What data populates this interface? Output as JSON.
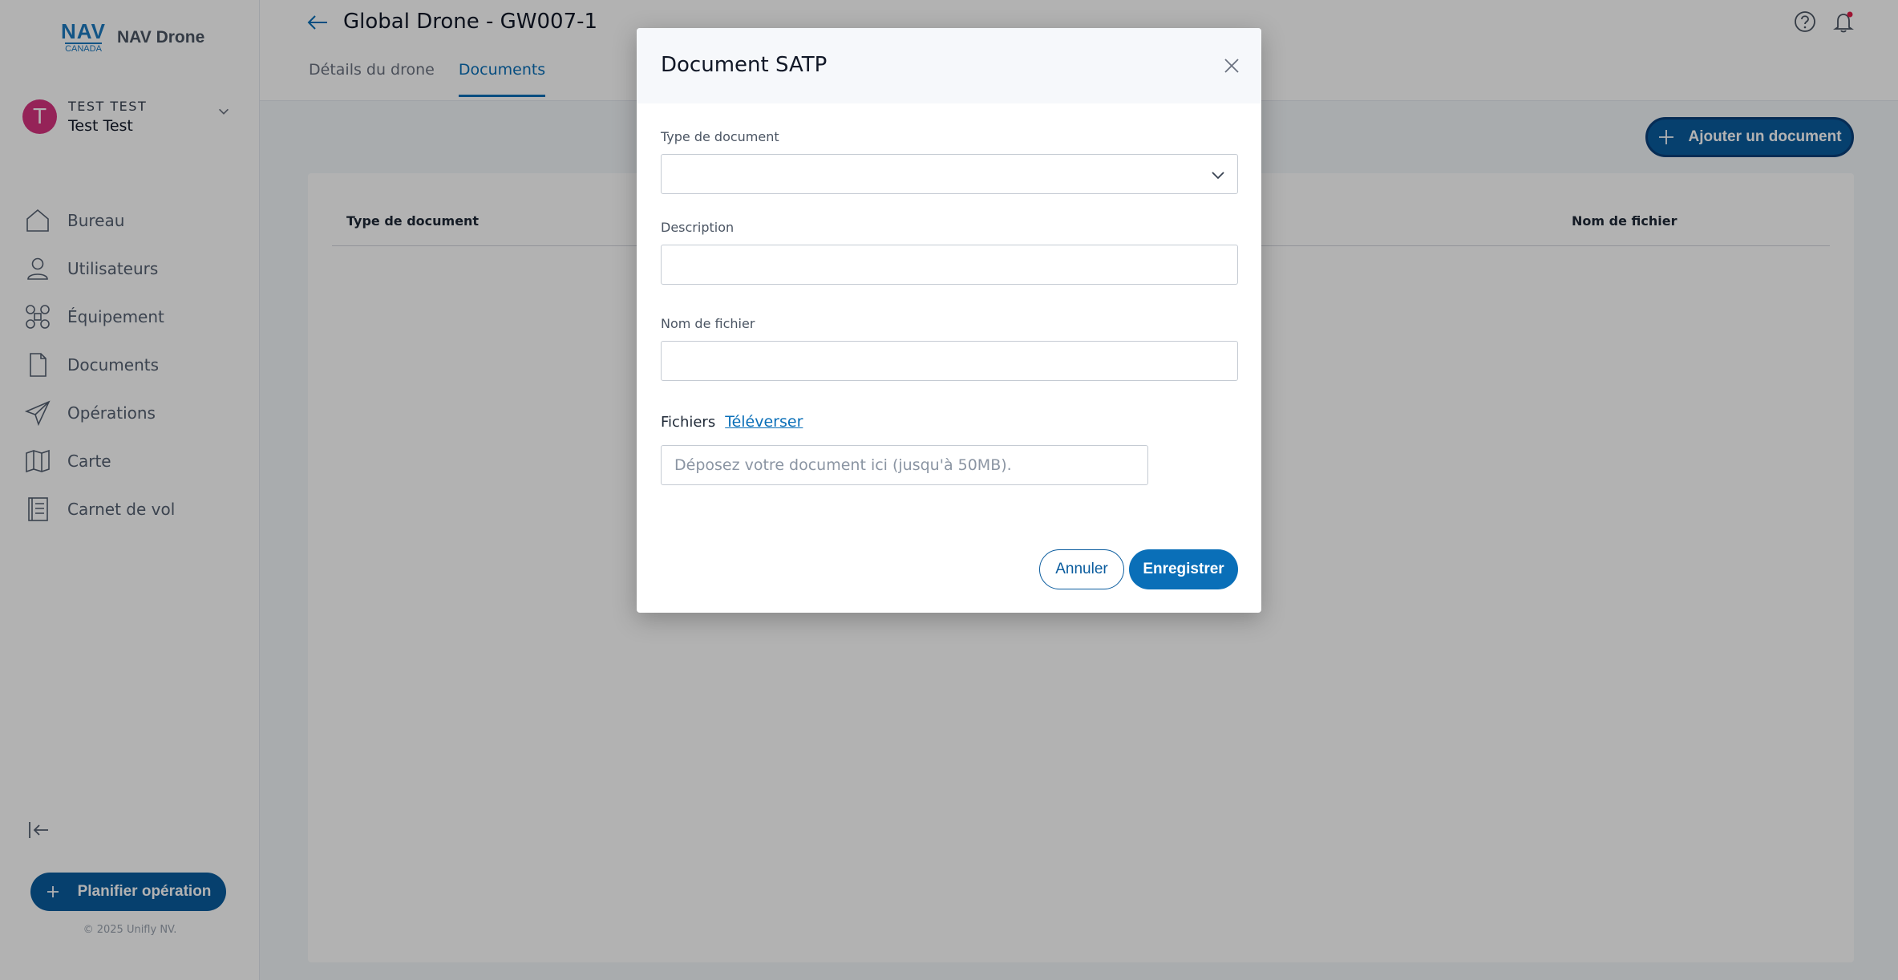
{
  "brand": {
    "logo_mark": "NAV",
    "logo_sub": "CANADA",
    "app_name": "NAV Drone"
  },
  "user": {
    "initial": "T",
    "upper_name": "TEST TEST",
    "name": "Test Test"
  },
  "nav": {
    "items": [
      {
        "label": "Bureau",
        "icon": "home-icon"
      },
      {
        "label": "Utilisateurs",
        "icon": "user-icon"
      },
      {
        "label": "Équipement",
        "icon": "drone-icon"
      },
      {
        "label": "Documents",
        "icon": "document-icon"
      },
      {
        "label": "Opérations",
        "icon": "paper-plane-icon"
      },
      {
        "label": "Carte",
        "icon": "map-icon"
      },
      {
        "label": "Carnet de vol",
        "icon": "logbook-icon"
      }
    ]
  },
  "sidebar_footer": {
    "plan_button": "Planifier opération",
    "copyright": "© 2025 Unifly NV."
  },
  "header": {
    "title": "Global Drone - GW007-1",
    "tabs": [
      {
        "label": "Détails du drone",
        "active": false
      },
      {
        "label": "Documents",
        "active": true
      }
    ]
  },
  "main": {
    "add_button": "Ajouter un document",
    "columns": [
      "Type de document",
      "Nom de fichier"
    ]
  },
  "modal": {
    "title": "Document SATP",
    "type_label": "Type de document",
    "type_value": "",
    "description_label": "Description",
    "description_value": "",
    "filename_label": "Nom de fichier",
    "filename_value": "",
    "files_label": "Fichiers",
    "upload_link": "Téléverser",
    "dropzone_placeholder": "Déposez votre document ici (jusqu'à 50MB).",
    "cancel_button": "Annuler",
    "save_button": "Enregistrer"
  },
  "colors": {
    "primary": "#0a6fb8",
    "primary_dark": "#0a5c9e",
    "avatar": "#d6337f"
  }
}
